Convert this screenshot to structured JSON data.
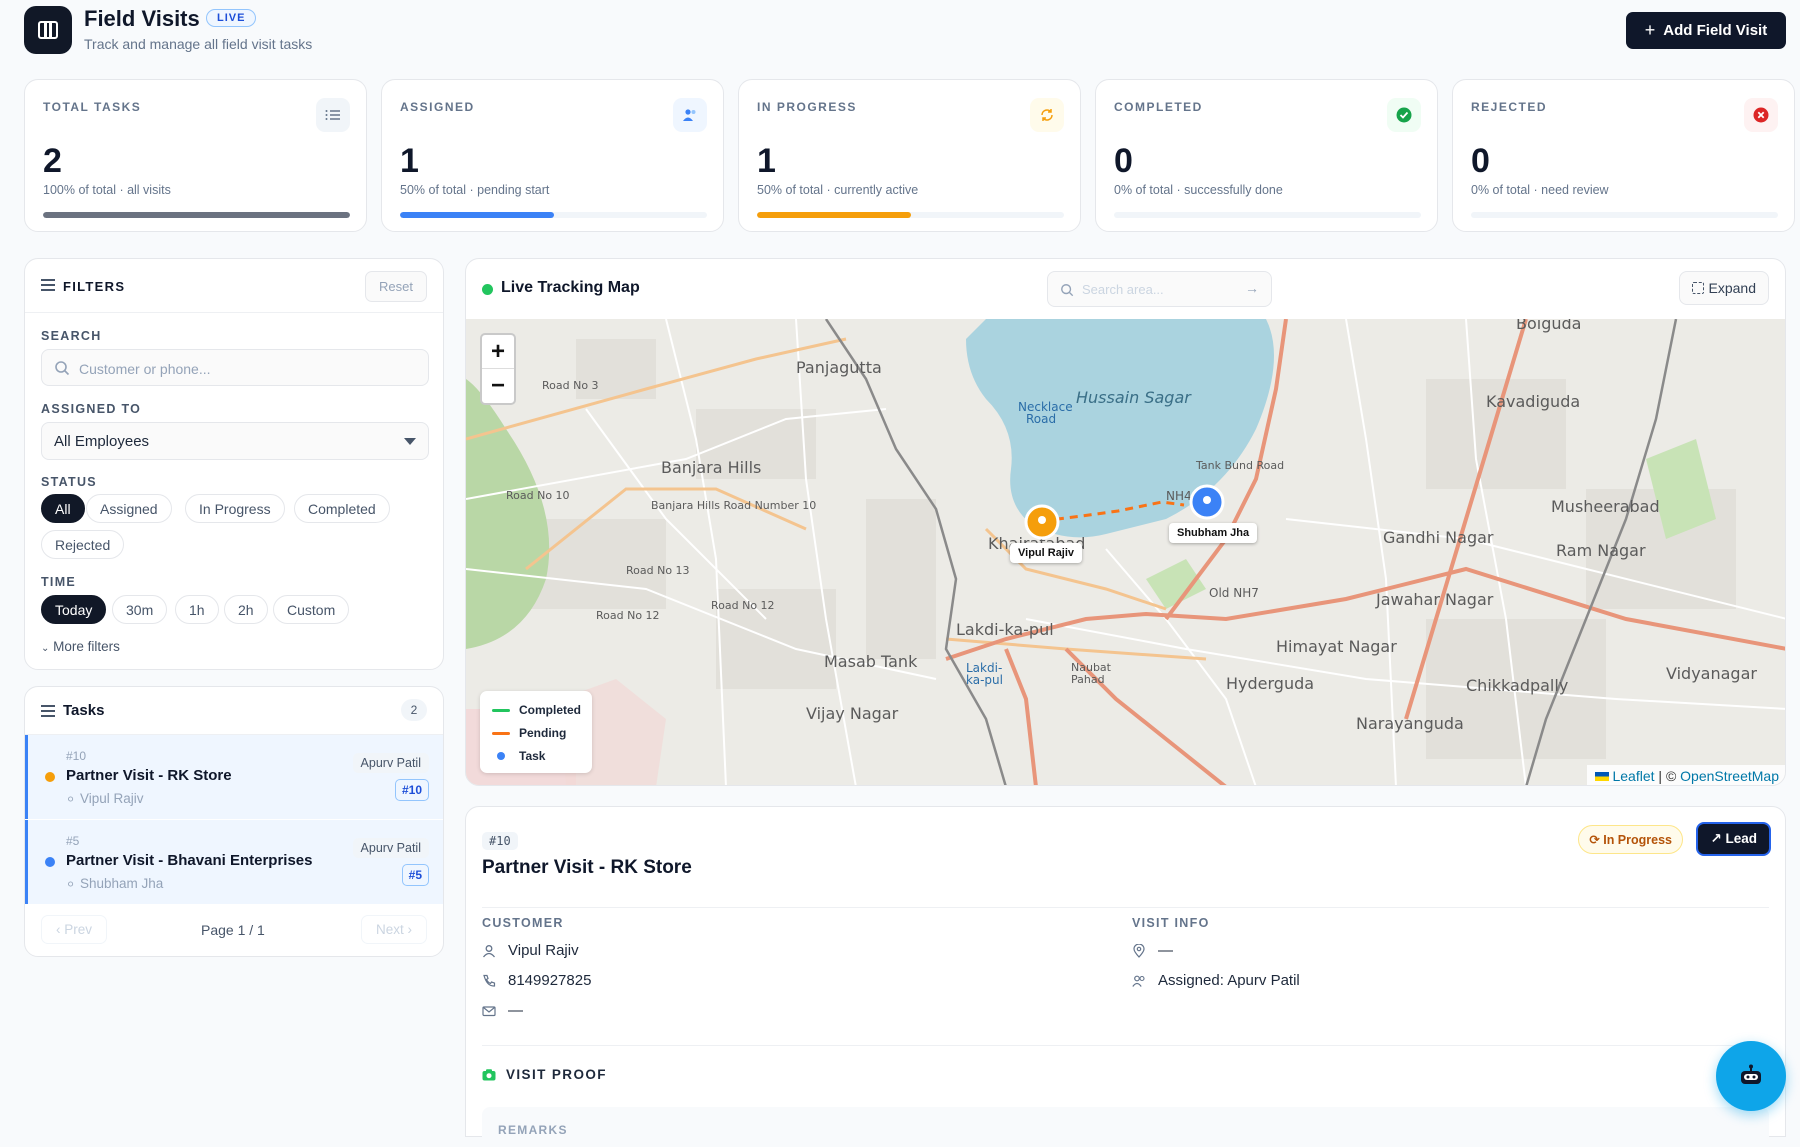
{
  "header": {
    "title": "Field Visits",
    "live_badge": "LIVE",
    "subtitle": "Track and manage all field visit tasks",
    "add_button": "Add Field Visit"
  },
  "stats": [
    {
      "label": "TOTAL TASKS",
      "value": "2",
      "sub": "100% of total · all visits",
      "progress": 1.0,
      "color": "#6b7280",
      "icon": "list-icon"
    },
    {
      "label": "ASSIGNED",
      "value": "1",
      "sub": "50% of total · pending start",
      "progress": 0.5,
      "color": "#3b82f6",
      "icon": "users-icon"
    },
    {
      "label": "IN PROGRESS",
      "value": "1",
      "sub": "50% of total · currently active",
      "progress": 0.5,
      "color": "#f59e0b",
      "icon": "refresh-icon"
    },
    {
      "label": "COMPLETED",
      "value": "0",
      "sub": "0% of total · successfully done",
      "progress": 0.0,
      "color": "#22c55e",
      "icon": "check-circle-icon"
    },
    {
      "label": "REJECTED",
      "value": "0",
      "sub": "0% of total · need review",
      "progress": 0.0,
      "color": "#ef4444",
      "icon": "x-circle-icon"
    }
  ],
  "filters": {
    "title": "FILTERS",
    "reset": "Reset",
    "search_label": "SEARCH",
    "search_placeholder": "Customer or phone...",
    "assigned_label": "ASSIGNED TO",
    "assigned_value": "All Employees",
    "status_label": "STATUS",
    "status_options": [
      "All",
      "Assigned",
      "In Progress",
      "Completed",
      "Rejected"
    ],
    "status_selected": "All",
    "time_label": "TIME",
    "time_options": [
      "Today",
      "30m",
      "1h",
      "2h",
      "Custom"
    ],
    "time_selected": "Today",
    "more_filters": "More filters"
  },
  "tasks": {
    "title": "Tasks",
    "count": "2",
    "items": [
      {
        "id": "#10",
        "name": "Partner Visit - RK Store",
        "customer": "Vipul Rajiv",
        "assignee": "Apurv Patil",
        "tag": "#10",
        "status_color": "#f59e0b"
      },
      {
        "id": "#5",
        "name": "Partner Visit - Bhavani Enterprises",
        "customer": "Shubham Jha",
        "assignee": "Apurv Patil",
        "tag": "#5",
        "status_color": "#3b82f6"
      }
    ],
    "prev": "Prev",
    "page_info": "Page 1 / 1",
    "next": "Next"
  },
  "map": {
    "title": "Live Tracking Map",
    "search_placeholder": "Search area...",
    "expand": "Expand",
    "zoom_in": "+",
    "zoom_out": "−",
    "legend": [
      {
        "label": "Completed",
        "color": "#22c55e"
      },
      {
        "label": "Pending",
        "color": "#f97316"
      },
      {
        "label": "Task",
        "color": "#3b82f6"
      }
    ],
    "pins": [
      {
        "label": "Vipul Rajiv",
        "color": "#f59e0b"
      },
      {
        "label": "Shubham Jha",
        "color": "#3b82f6"
      }
    ],
    "place_labels": [
      "Panjagutta",
      "Hussain Sagar",
      "Kavadiguda",
      "Banjara Hills",
      "Khairatabad",
      "Gandhi Nagar",
      "Musheerabad",
      "Ram Nagar",
      "Jawahar Nagar",
      "Lakdi-ka-pul",
      "Masab Tank",
      "Himayat Nagar",
      "Hyderguda",
      "Chikkadpally",
      "Vidyanagar",
      "Vijay Nagar",
      "Narayanguda",
      "Boiguda",
      "Necklace Road",
      "Old NH7",
      "NH44",
      "Road No 3",
      "Road No 12",
      "Road No 13",
      "Road No 10",
      "Banjara Hills Road Number 10",
      "Tank Bund Road",
      "Lakdi-ka-pul",
      "Naubat Pahad"
    ],
    "attribution_leaflet": "Leaflet",
    "attribution_sep": " | © ",
    "attribution_osm": "OpenStreetMap"
  },
  "detail": {
    "id": "#10",
    "title": "Partner Visit - RK Store",
    "status": "In Progress",
    "lead_button": "Lead",
    "customer_label": "CUSTOMER",
    "customer_name": "Vipul Rajiv",
    "customer_phone": "8149927825",
    "customer_email": "—",
    "visit_label": "VISIT INFO",
    "visit_location": "—",
    "visit_assigned": "Assigned: Apurv Patil",
    "proof_label": "VISIT PROOF",
    "remarks_label": "REMARKS"
  }
}
